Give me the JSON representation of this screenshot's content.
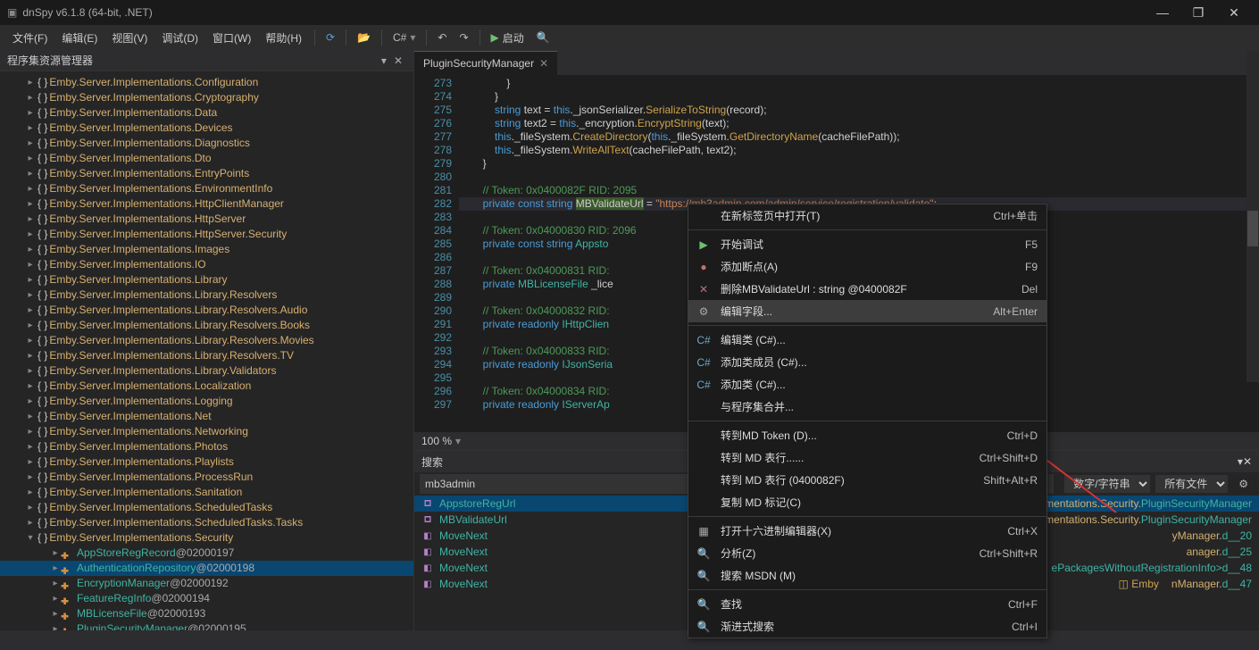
{
  "title": "dnSpy v6.1.8 (64-bit, .NET)",
  "menu": [
    "文件(F)",
    "编辑(E)",
    "视图(V)",
    "调试(D)",
    "窗口(W)",
    "帮助(H)"
  ],
  "language_dropdown": "C#",
  "run_label": "启动",
  "panel_title": "程序集资源管理器",
  "tree": [
    {
      "t": "ns",
      "l": "Emby.Server.Implementations.Configuration"
    },
    {
      "t": "ns",
      "l": "Emby.Server.Implementations.Cryptography"
    },
    {
      "t": "ns",
      "l": "Emby.Server.Implementations.Data"
    },
    {
      "t": "ns",
      "l": "Emby.Server.Implementations.Devices"
    },
    {
      "t": "ns",
      "l": "Emby.Server.Implementations.Diagnostics"
    },
    {
      "t": "ns",
      "l": "Emby.Server.Implementations.Dto"
    },
    {
      "t": "ns",
      "l": "Emby.Server.Implementations.EntryPoints"
    },
    {
      "t": "ns",
      "l": "Emby.Server.Implementations.EnvironmentInfo"
    },
    {
      "t": "ns",
      "l": "Emby.Server.Implementations.HttpClientManager"
    },
    {
      "t": "ns",
      "l": "Emby.Server.Implementations.HttpServer"
    },
    {
      "t": "ns",
      "l": "Emby.Server.Implementations.HttpServer.Security"
    },
    {
      "t": "ns",
      "l": "Emby.Server.Implementations.Images"
    },
    {
      "t": "ns",
      "l": "Emby.Server.Implementations.IO"
    },
    {
      "t": "ns",
      "l": "Emby.Server.Implementations.Library"
    },
    {
      "t": "ns",
      "l": "Emby.Server.Implementations.Library.Resolvers"
    },
    {
      "t": "ns",
      "l": "Emby.Server.Implementations.Library.Resolvers.Audio"
    },
    {
      "t": "ns",
      "l": "Emby.Server.Implementations.Library.Resolvers.Books"
    },
    {
      "t": "ns",
      "l": "Emby.Server.Implementations.Library.Resolvers.Movies"
    },
    {
      "t": "ns",
      "l": "Emby.Server.Implementations.Library.Resolvers.TV"
    },
    {
      "t": "ns",
      "l": "Emby.Server.Implementations.Library.Validators"
    },
    {
      "t": "ns",
      "l": "Emby.Server.Implementations.Localization"
    },
    {
      "t": "ns",
      "l": "Emby.Server.Implementations.Logging"
    },
    {
      "t": "ns",
      "l": "Emby.Server.Implementations.Net"
    },
    {
      "t": "ns",
      "l": "Emby.Server.Implementations.Networking"
    },
    {
      "t": "ns",
      "l": "Emby.Server.Implementations.Photos"
    },
    {
      "t": "ns",
      "l": "Emby.Server.Implementations.Playlists"
    },
    {
      "t": "ns",
      "l": "Emby.Server.Implementations.ProcessRun"
    },
    {
      "t": "ns",
      "l": "Emby.Server.Implementations.Sanitation"
    },
    {
      "t": "ns",
      "l": "Emby.Server.Implementations.ScheduledTasks"
    },
    {
      "t": "ns",
      "l": "Emby.Server.Implementations.ScheduledTasks.Tasks"
    },
    {
      "t": "ns",
      "l": "Emby.Server.Implementations.Security",
      "open": true,
      "children": [
        {
          "l": "AppStoreRegRecord",
          "a": "@02000197"
        },
        {
          "l": "AuthenticationRepository",
          "a": "@02000198",
          "sel": true
        },
        {
          "l": "EncryptionManager",
          "a": "@02000192"
        },
        {
          "l": "FeatureRegInfo",
          "a": "@02000194"
        },
        {
          "l": "MBLicenseFile",
          "a": "@02000193"
        },
        {
          "l": "PluginSecurityManager",
          "a": "@02000195"
        }
      ]
    }
  ],
  "tab_label": "PluginSecurityManager",
  "line_start": 273,
  "code_lines": [
    "                }",
    "            }",
    "            <span class='c-kw'>string</span> <span class='c-id'>text</span> = <span class='c-kw'>this</span>.<span class='c-id'>_jsonSerializer</span>.<span class='c-me'>SerializeToString</span>(<span class='c-id'>record</span>);",
    "            <span class='c-kw'>string</span> <span class='c-id'>text2</span> = <span class='c-kw'>this</span>.<span class='c-id'>_encryption</span>.<span class='c-me'>EncryptString</span>(<span class='c-id'>text</span>);",
    "            <span class='c-kw'>this</span>.<span class='c-id'>_fileSystem</span>.<span class='c-me'>CreateDirectory</span>(<span class='c-kw'>this</span>.<span class='c-id'>_fileSystem</span>.<span class='c-me'>GetDirectoryName</span>(<span class='c-id'>cacheFilePath</span>));",
    "            <span class='c-kw'>this</span>.<span class='c-id'>_fileSystem</span>.<span class='c-me'>WriteAllText</span>(<span class='c-id'>cacheFilePath</span>, <span class='c-id'>text2</span>);",
    "        }",
    "",
    "        <span class='c-cm'>// Token: 0x0400082F RID: 2095</span>",
    "        <span class='c-kw'>private const string</span> <span class='hl-sel'>MBValidateUrl</span> = <span class='c-st'>\"https://mb3admin.com/admin/service/registration/validate\"</span>;",
    "",
    "        <span class='c-cm'>// Token: 0x04000830 RID: 2096</span>",
    "        <span class='c-kw'>private const string</span> <span class='c-ty'>Appsto</span>                                                                              <span class='c-st'>/register\"</span>;",
    "",
    "        <span class='c-cm'>// Token: 0x04000831 RID:</span>",
    "        <span class='c-kw'>private</span> <span class='c-ty'>MBLicenseFile</span> <span class='c-id'>_lice</span>",
    "",
    "        <span class='c-cm'>// Token: 0x04000832 RID:</span>",
    "        <span class='c-kw'>private readonly</span> <span class='c-ty'>IHttpClien</span>",
    "",
    "        <span class='c-cm'>// Token: 0x04000833 RID:</span>",
    "        <span class='c-kw'>private readonly</span> <span class='c-ty'>IJsonSeria</span>",
    "",
    "        <span class='c-cm'>// Token: 0x04000834 RID:</span>",
    "        <span class='c-kw'>private readonly</span> <span class='c-ty'>IServerAp</span>"
  ],
  "zoom": "100 %",
  "search_title": "搜索",
  "search_value": "mb3admin",
  "filter1": "数字/字符串",
  "filter2": "所有文件",
  "results": [
    {
      "ico": "field",
      "name": "AppstoreRegUrl",
      "path": "mentations.Security.",
      "cls": "PluginSecurityManager",
      "sel": true
    },
    {
      "ico": "field",
      "name": "MBValidateUrl",
      "path": "mentations.Security.",
      "cls": "PluginSecurityManager"
    },
    {
      "ico": "method",
      "name": "MoveNext",
      "path": "yManager.",
      "cls": "<RegisterAppStoreSale>d__20"
    },
    {
      "ico": "method",
      "name": "MoveNext",
      "path": "anager.",
      "cls": "<UpdateRegistrationStatus>d__25"
    },
    {
      "ico": "method",
      "name": "MoveNext",
      "path": "",
      "cls": "ePackagesWithoutRegistrationInfo>d__48"
    },
    {
      "ico": "method",
      "name": "MoveNext",
      "path": "nManager.",
      "cls": "<GetAvailablePackages>d__47"
    }
  ],
  "emby_label": "Emby",
  "context_menu": [
    {
      "ico": "",
      "l": "在新标签页中打开(T)",
      "k": "Ctrl+单击"
    },
    {
      "sep": true
    },
    {
      "ico": "▶",
      "l": "开始调试",
      "k": "F5",
      "c": "#6fbf6f"
    },
    {
      "ico": "●",
      "l": "添加断点(A)",
      "k": "F9",
      "c": "#c76d6d"
    },
    {
      "ico": "✕",
      "l": "删除MBValidateUrl : string @0400082F",
      "k": "Del",
      "c": "#c76d6d"
    },
    {
      "ico": "⚙",
      "l": "编辑字段...",
      "k": "Alt+Enter",
      "hl": true
    },
    {
      "sep": true
    },
    {
      "ico": "C#",
      "l": "编辑类 (C#)...",
      "k": "",
      "c": "#6fa8c7"
    },
    {
      "ico": "C#",
      "l": "添加类成员 (C#)...",
      "k": "",
      "c": "#6fa8c7"
    },
    {
      "ico": "C#",
      "l": "添加类 (C#)...",
      "k": "",
      "c": "#6fa8c7"
    },
    {
      "ico": "",
      "l": "与程序集合并...",
      "k": ""
    },
    {
      "sep": true
    },
    {
      "ico": "",
      "l": "转到MD Token (D)...",
      "k": "Ctrl+D"
    },
    {
      "ico": "",
      "l": "转到 MD 表行......",
      "k": "Ctrl+Shift+D"
    },
    {
      "ico": "",
      "l": "转到 MD 表行 (0400082F)",
      "k": "Shift+Alt+R"
    },
    {
      "ico": "",
      "l": "复制 MD 标记(C)",
      "k": ""
    },
    {
      "sep": true
    },
    {
      "ico": "▦",
      "l": "打开十六进制编辑器(X)",
      "k": "Ctrl+X"
    },
    {
      "ico": "🔍",
      "l": "分析(Z)",
      "k": "Ctrl+Shift+R"
    },
    {
      "ico": "🔍",
      "l": "搜索 MSDN (M)",
      "k": ""
    },
    {
      "sep": true
    },
    {
      "ico": "🔍",
      "l": "查找",
      "k": "Ctrl+F"
    },
    {
      "ico": "🔍",
      "l": "渐进式搜索",
      "k": "Ctrl+I"
    }
  ]
}
